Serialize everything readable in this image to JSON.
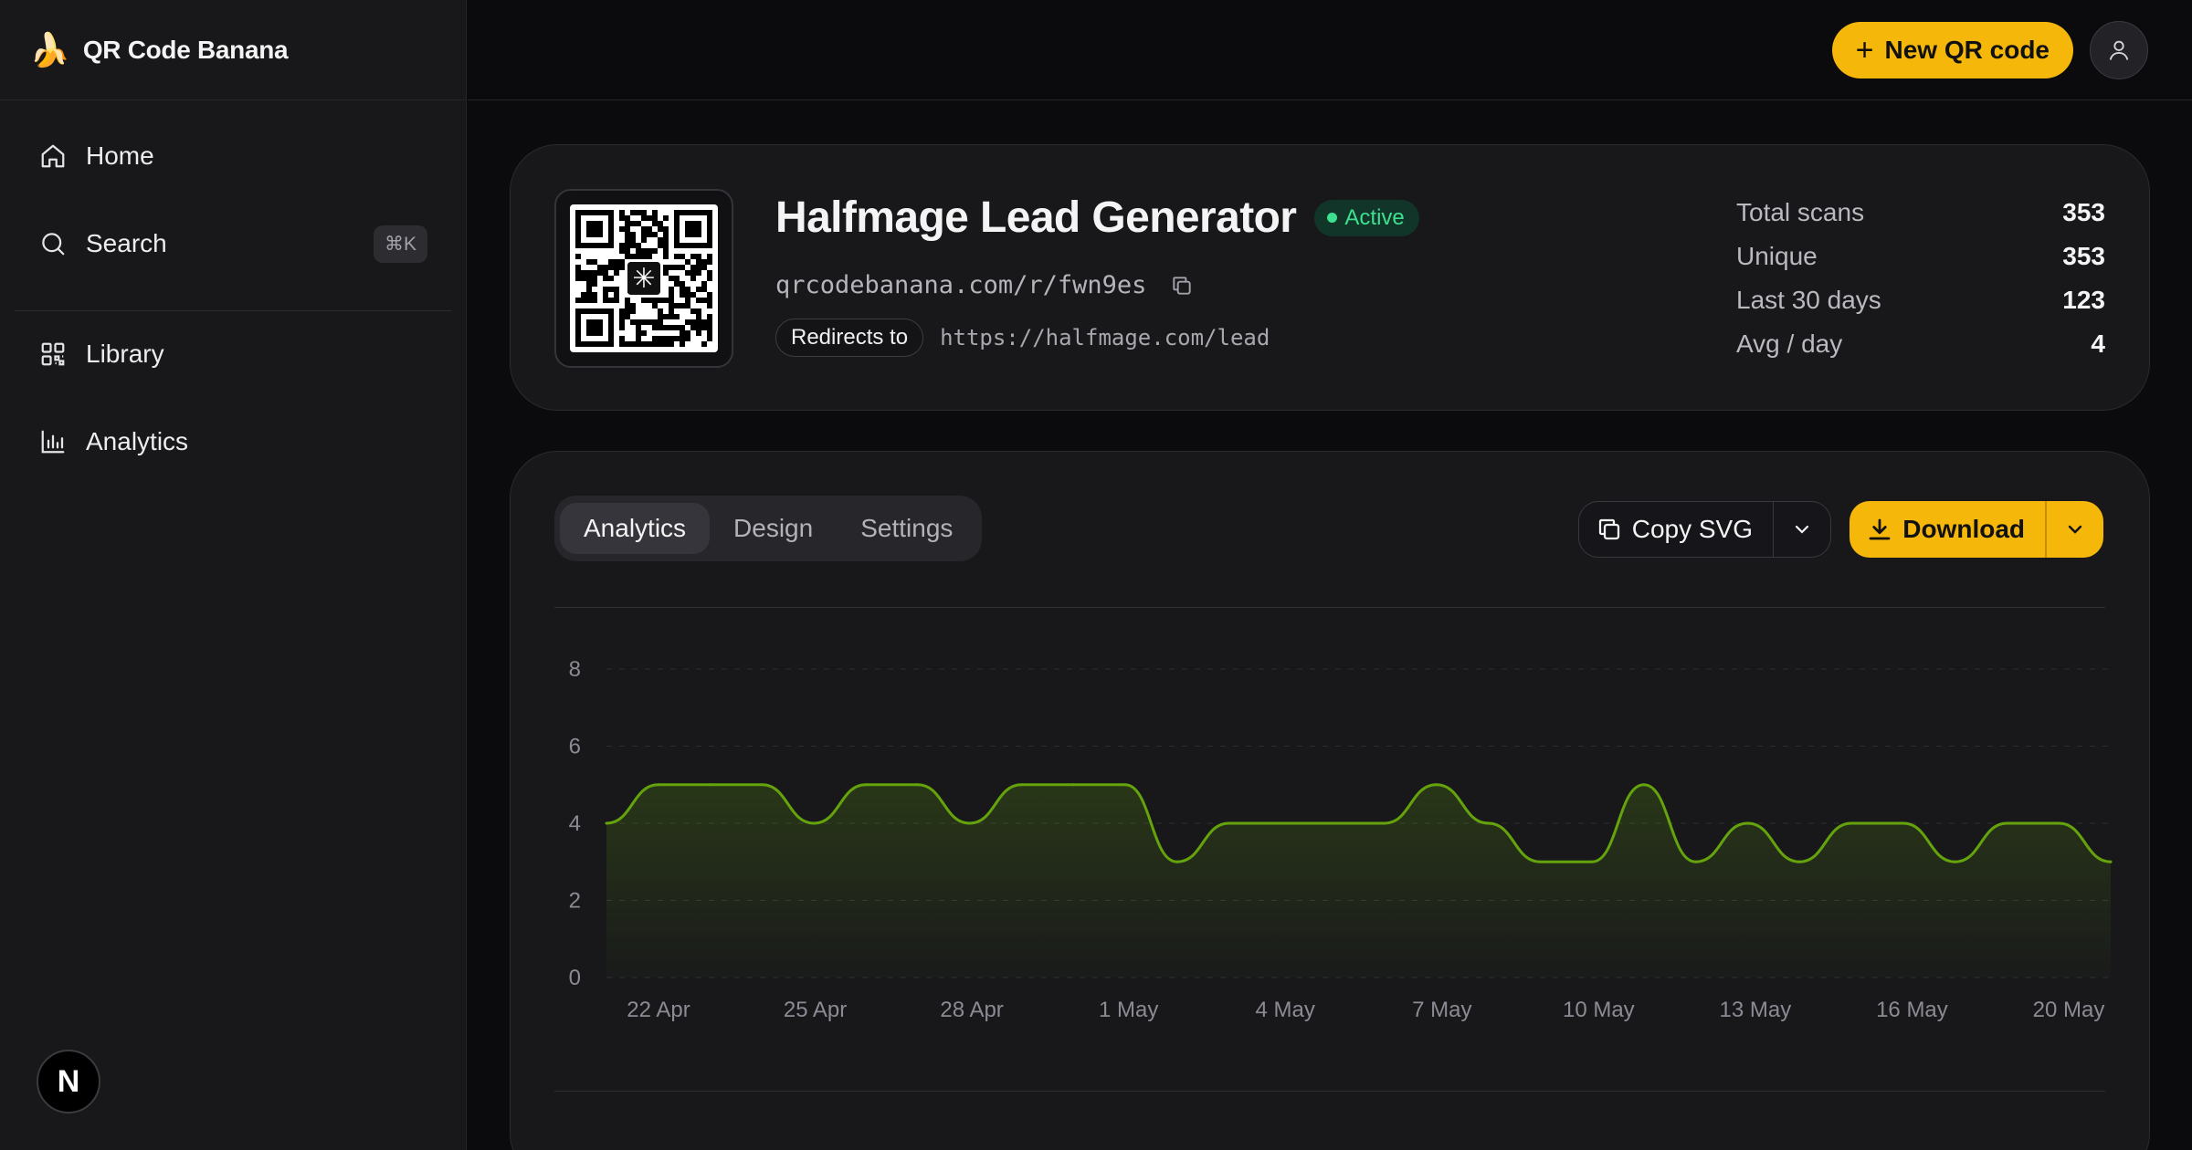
{
  "app": {
    "name": "QR Code Banana",
    "logo_emoji": "🍌"
  },
  "sidebar": {
    "items": [
      {
        "label": "Home",
        "icon": "home-icon"
      },
      {
        "label": "Search",
        "icon": "search-icon",
        "shortcut": "⌘K"
      },
      {
        "label": "Library",
        "icon": "qr-grid-icon"
      },
      {
        "label": "Analytics",
        "icon": "bar-chart-icon"
      }
    ],
    "footer_badge": "N"
  },
  "topbar": {
    "new_button": "New QR code",
    "avatar_icon": "user-icon"
  },
  "qr": {
    "title": "Halfmage Lead Generator",
    "status": "Active",
    "short_url": "qrcodebanana.com/r/fwn9es",
    "redirect_label": "Redirects to",
    "redirect_url": "https://halfmage.com/lead"
  },
  "stats": [
    {
      "label": "Total scans",
      "value": "353"
    },
    {
      "label": "Unique",
      "value": "353"
    },
    {
      "label": "Last 30 days",
      "value": "123"
    },
    {
      "label": "Avg / day",
      "value": "4"
    }
  ],
  "tabs": [
    {
      "label": "Analytics",
      "active": true
    },
    {
      "label": "Design",
      "active": false
    },
    {
      "label": "Settings",
      "active": false
    }
  ],
  "actions": {
    "copy_svg": "Copy SVG",
    "download": "Download"
  },
  "colors": {
    "accent": "#f5b70a",
    "line": "#65a30d",
    "active_green": "#3ee08f"
  },
  "chart_data": {
    "type": "area",
    "x_ticks": [
      "22 Apr",
      "25 Apr",
      "28 Apr",
      "1 May",
      "4 May",
      "7 May",
      "10 May",
      "13 May",
      "16 May",
      "20 May"
    ],
    "y_ticks": [
      "0",
      "2",
      "4",
      "6",
      "8"
    ],
    "ylim": [
      0,
      8
    ],
    "grid": true,
    "series": [
      {
        "values": [
          4,
          5,
          5,
          5,
          4,
          5,
          5,
          4,
          5,
          5,
          5,
          3,
          4,
          4,
          4,
          4,
          5,
          4,
          3,
          3,
          5,
          3,
          4,
          3,
          4,
          4,
          3,
          4,
          4,
          3
        ]
      }
    ]
  }
}
